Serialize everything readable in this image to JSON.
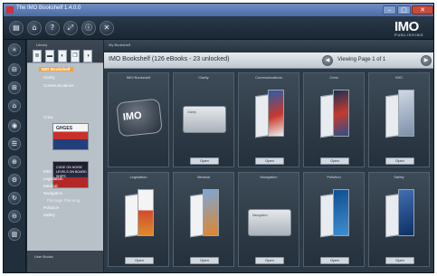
{
  "window": {
    "title": "The IMO Bookshelf 1.4.0.0"
  },
  "toolbar": {
    "buttons": [
      "▤",
      "⌂",
      "?",
      "⤢",
      "ⓘ",
      "✕"
    ],
    "logo_big": "IMO",
    "logo_small": "PUBLISHING"
  },
  "rail": {
    "buttons": [
      "«",
      "⊟",
      "⊞",
      "⌂",
      "◉",
      "☰",
      "⊕",
      "⚙",
      "↻",
      "⊖",
      "▥"
    ]
  },
  "library": {
    "header": "Library",
    "tools": [
      "≣",
      "▬",
      "◐",
      "❐",
      "◑"
    ],
    "tree": {
      "selected": "IMO Bookshelf",
      "items": [
        "Clarity",
        "Communications",
        "Crew",
        "IMO",
        "Legislation",
        "Medical",
        "Navigation",
        "Passage Planning",
        "Pollution",
        "Safety"
      ]
    },
    "thumbs": {
      "ghg": "GHGES",
      "code": "CODE ON NOISE LEVELS ON BOARD SHIPS"
    },
    "footer": "User Books"
  },
  "main": {
    "header": "My Bookshelf",
    "title": "IMO Bookshelf (126 eBooks - 23 unlocked)",
    "page_label": "Viewing Page 1 of 1",
    "open_label": "Open"
  },
  "tiles": [
    {
      "label": "IMO Bookshelf",
      "art": "badge"
    },
    {
      "label": "Clarity",
      "art": "folder"
    },
    {
      "label": "Communications",
      "art": "open"
    },
    {
      "label": "Crew",
      "art": "open"
    },
    {
      "label": "IMO",
      "art": "open"
    },
    {
      "label": "Legislation",
      "art": "open"
    },
    {
      "label": "Medical",
      "art": "open"
    },
    {
      "label": "Navigation",
      "art": "folder"
    },
    {
      "label": "Pollution",
      "art": "open"
    },
    {
      "label": "Safety",
      "art": "open"
    }
  ],
  "colors": {
    "accent": "#f2a23a",
    "panel_bg": "#2c3a47"
  }
}
